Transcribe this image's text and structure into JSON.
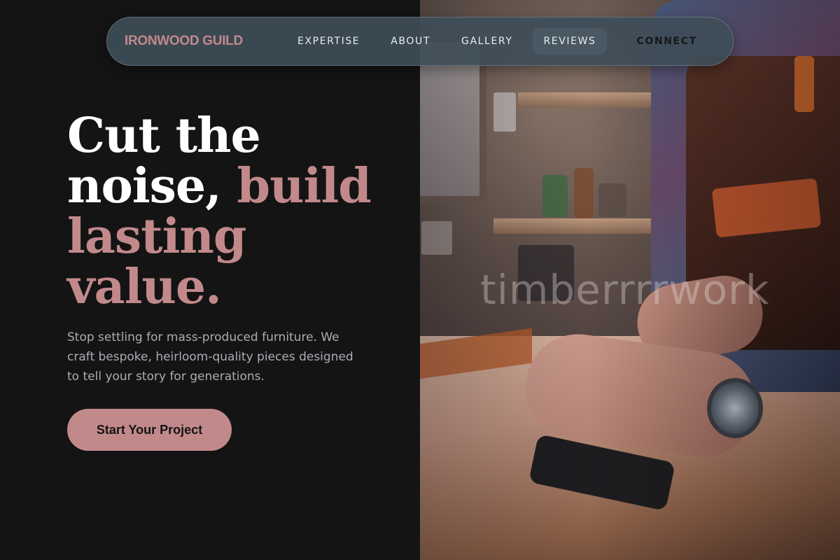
{
  "nav": {
    "brand": "IRONWOOD GUILD",
    "links": [
      {
        "label": "EXPERTISE"
      },
      {
        "label": "ABOUT"
      },
      {
        "label": "GALLERY"
      },
      {
        "label": "REVIEWS"
      },
      {
        "label": "CONNECT"
      }
    ]
  },
  "hero": {
    "title_line1": "Cut the",
    "title_line2a": "noise,",
    "title_line2b": "build",
    "title_line3": "lasting",
    "title_line4": "value.",
    "description": "Stop settling for mass-produced furniture. We craft bespoke, heirloom-quality pieces designed to tell your story for generations.",
    "cta_label": "Start Your Project"
  },
  "image": {
    "watermark": "timberrrrwork"
  },
  "colors": {
    "background": "#141414",
    "accent": "#c2898b",
    "nav_bg": "#3e4d58",
    "body_text": "#a9aeb4"
  }
}
